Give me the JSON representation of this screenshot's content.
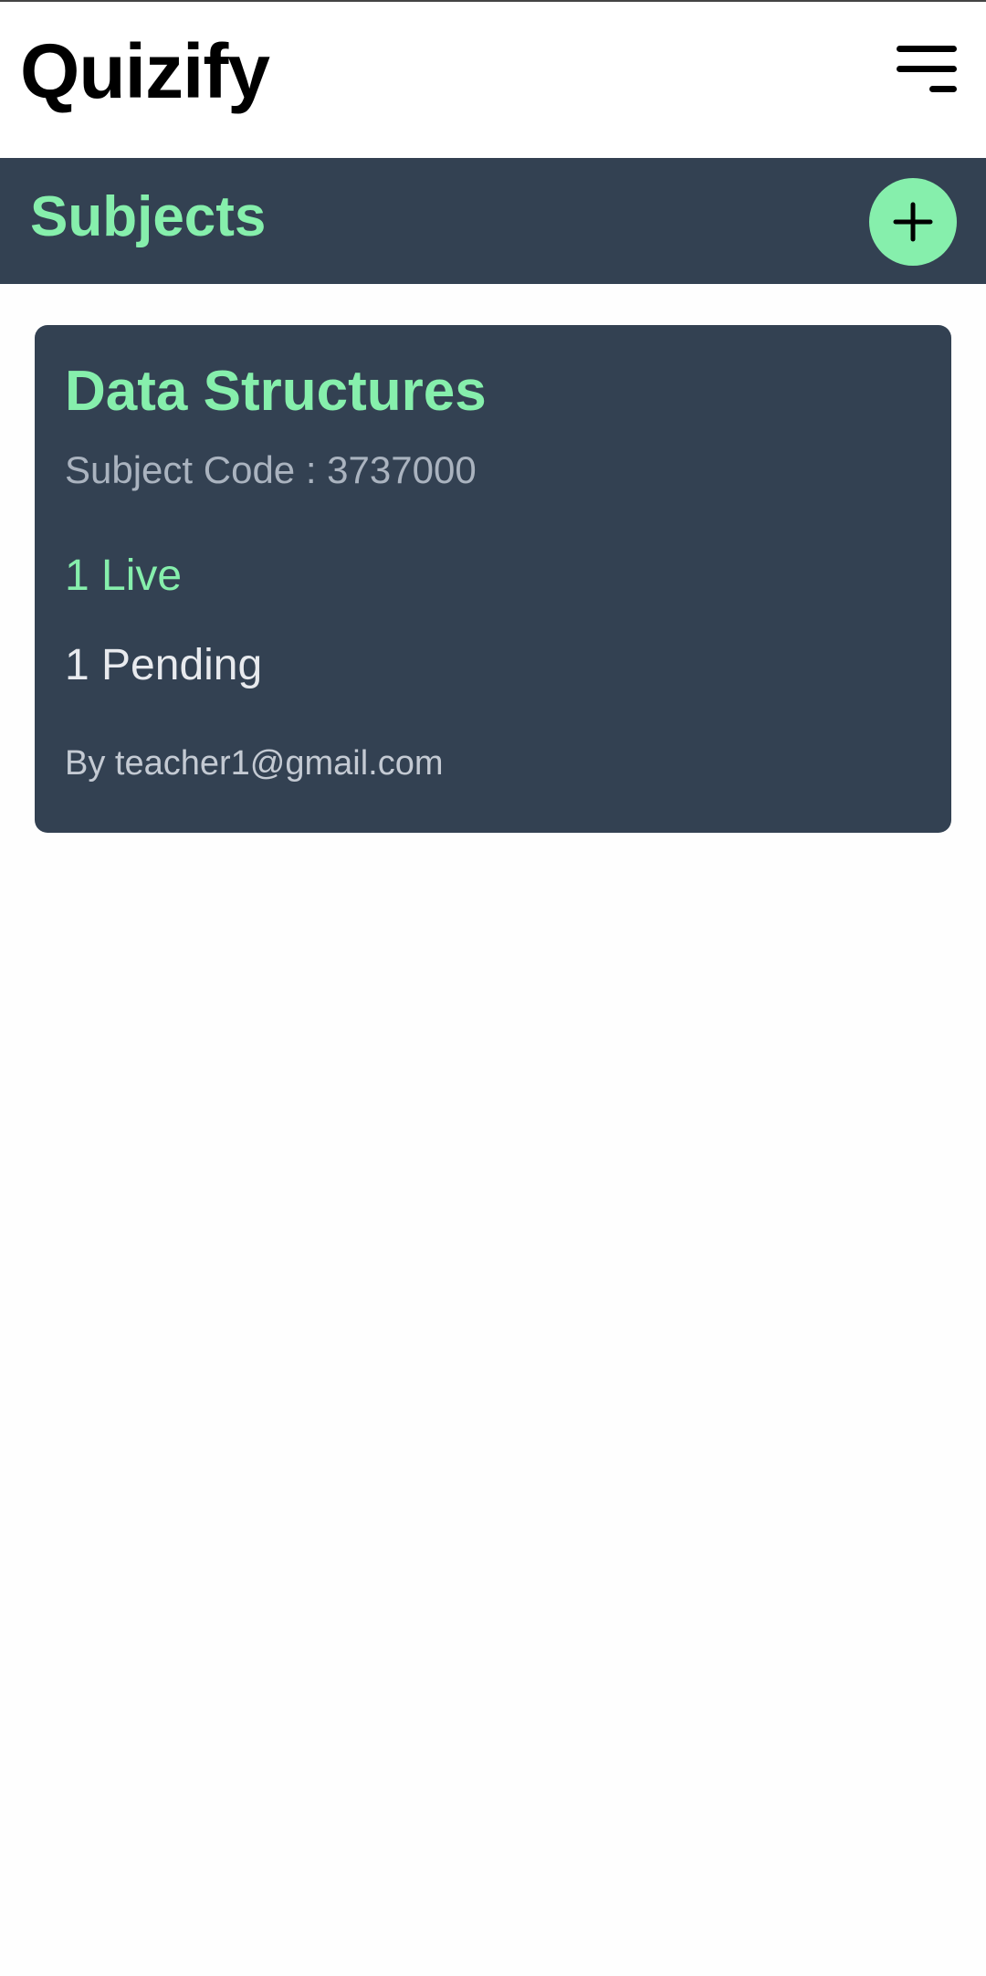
{
  "app": {
    "brand": "Quizify"
  },
  "header": {
    "menu_icon": "hamburger-menu-icon"
  },
  "subjects_bar": {
    "title": "Subjects",
    "add_icon": "plus-icon",
    "colors": {
      "background": "#334152",
      "accent": "#86efac"
    }
  },
  "subjects": [
    {
      "name": "Data Structures",
      "code_text": "Subject Code : 3737000",
      "live_text": "1 Live",
      "pending_text": "1 Pending",
      "author_text": "By teacher1@gmail.com"
    }
  ]
}
